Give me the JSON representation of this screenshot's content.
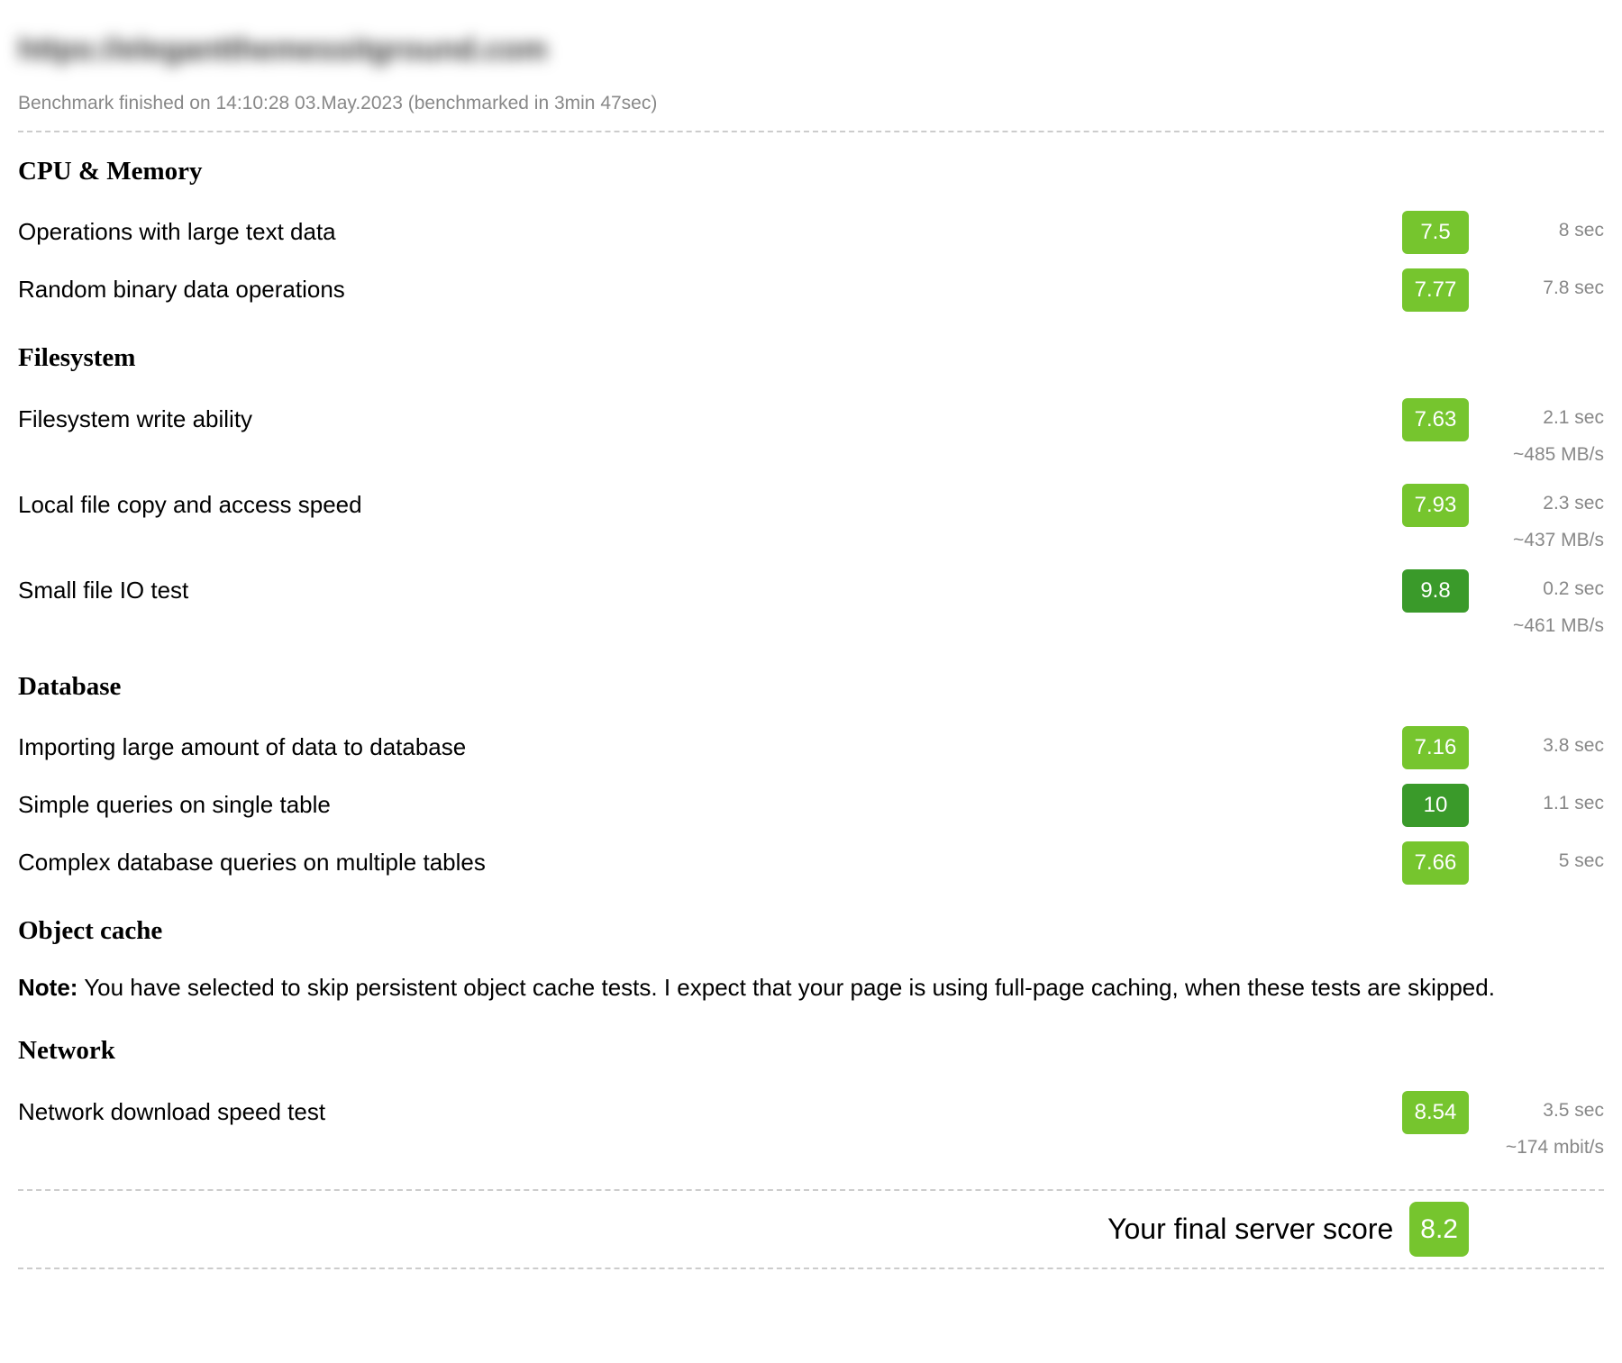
{
  "header": {
    "blurred_url": "https://elegantthemessitground.com",
    "meta": "Benchmark finished on 14:10:28 03.May.2023 (benchmarked in 3min 47sec)"
  },
  "sections": {
    "cpu_memory": {
      "title": "CPU & Memory",
      "tests": [
        {
          "label": "Operations with large text data",
          "score": "7.5",
          "score_class": "light",
          "detail1": "8 sec",
          "detail2": ""
        },
        {
          "label": "Random binary data operations",
          "score": "7.77",
          "score_class": "light",
          "detail1": "7.8 sec",
          "detail2": ""
        }
      ]
    },
    "filesystem": {
      "title": "Filesystem",
      "tests": [
        {
          "label": "Filesystem write ability",
          "score": "7.63",
          "score_class": "light",
          "detail1": "2.1 sec",
          "detail2": "~485 MB/s"
        },
        {
          "label": "Local file copy and access speed",
          "score": "7.93",
          "score_class": "light",
          "detail1": "2.3 sec",
          "detail2": "~437 MB/s"
        },
        {
          "label": "Small file IO test",
          "score": "9.8",
          "score_class": "dark",
          "detail1": "0.2 sec",
          "detail2": "~461 MB/s"
        }
      ]
    },
    "database": {
      "title": "Database",
      "tests": [
        {
          "label": "Importing large amount of data to database",
          "score": "7.16",
          "score_class": "light",
          "detail1": "3.8 sec",
          "detail2": ""
        },
        {
          "label": "Simple queries on single table",
          "score": "10",
          "score_class": "dark",
          "detail1": "1.1 sec",
          "detail2": ""
        },
        {
          "label": "Complex database queries on multiple tables",
          "score": "7.66",
          "score_class": "light",
          "detail1": "5 sec",
          "detail2": ""
        }
      ]
    },
    "object_cache": {
      "title": "Object cache",
      "note_prefix": "Note:",
      "note_body": " You have selected to skip persistent object cache tests. I expect that your page is using full-page caching, when these tests are skipped."
    },
    "network": {
      "title": "Network",
      "tests": [
        {
          "label": "Network download speed test",
          "score": "8.54",
          "score_class": "light",
          "detail1": "3.5 sec",
          "detail2": "~174 mbit/s"
        }
      ]
    }
  },
  "final": {
    "label": "Your final server score",
    "score": "8.2"
  }
}
